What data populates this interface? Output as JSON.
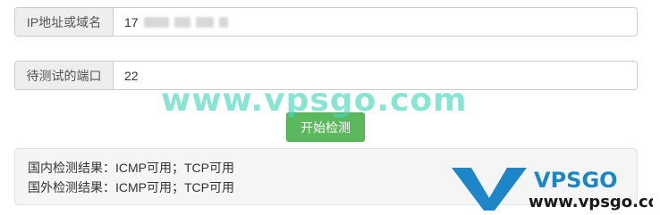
{
  "form": {
    "host_label": "IP地址或域名",
    "host_value_visible": "17",
    "port_label": "待测试的端口",
    "port_value": "22",
    "submit_label": "开始检测"
  },
  "result": {
    "line_domestic": "国内检测结果：ICMP可用；TCP可用",
    "line_foreign": "国外检测结果：ICMP可用；TCP可用"
  },
  "watermark": {
    "url_text": "www.vpsgo.com",
    "logo_wordmark": "VPSGO",
    "logo_url": "www.vpsgo.com",
    "color": "#48d6bb",
    "logo_color": "#1d86c6"
  }
}
